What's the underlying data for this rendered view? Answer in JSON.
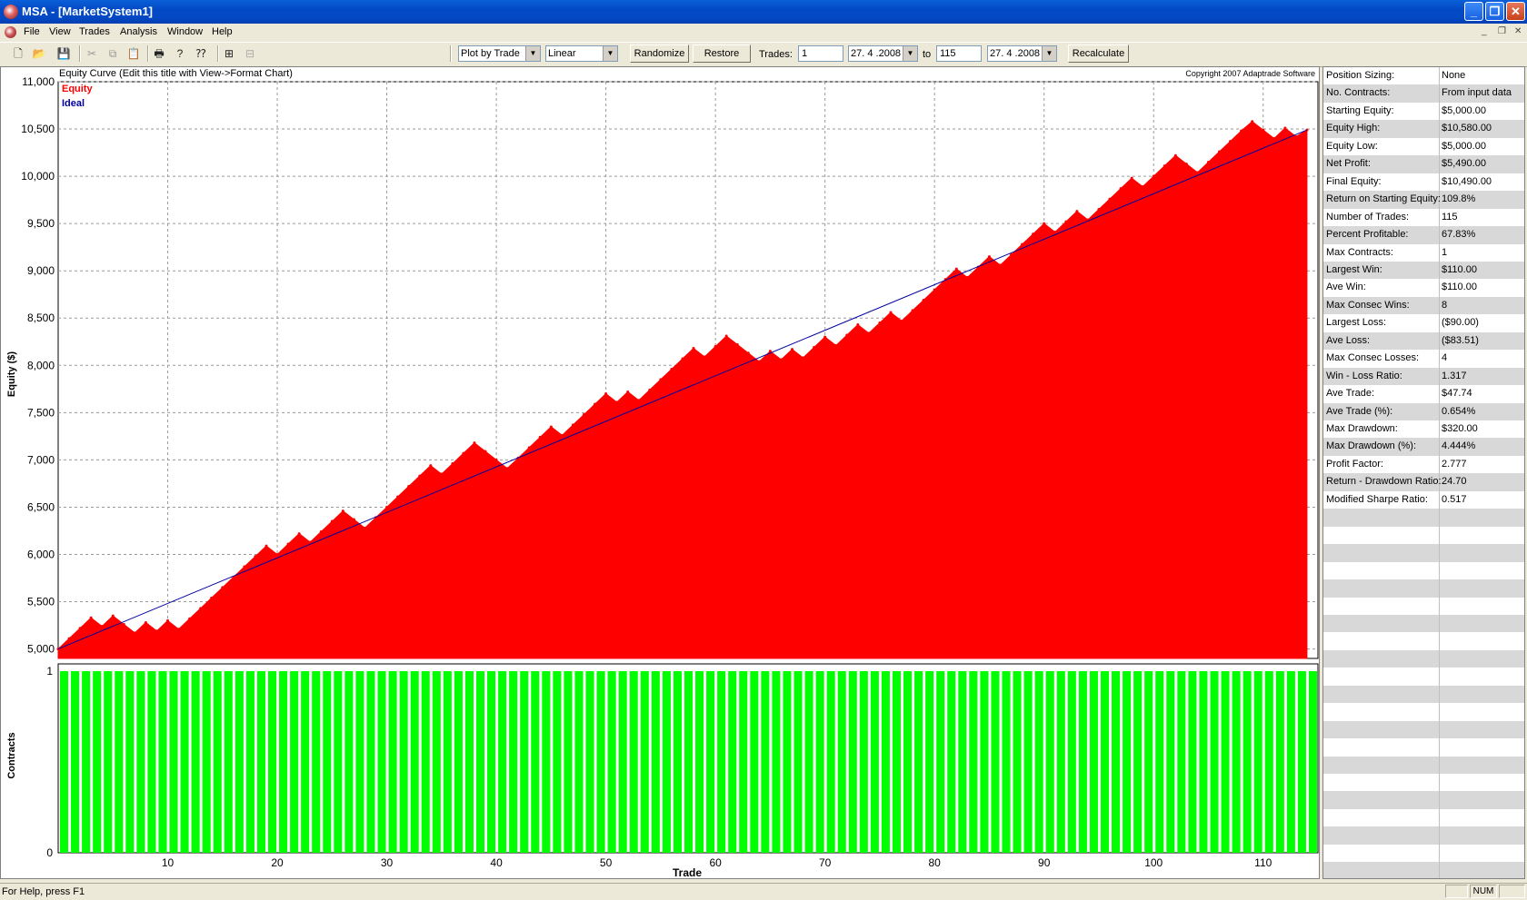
{
  "window": {
    "title": "MSA - [MarketSystem1]"
  },
  "menu": {
    "items": [
      "File",
      "View",
      "Trades",
      "Analysis",
      "Window",
      "Help"
    ]
  },
  "toolbar": {
    "plot_mode": "Plot by Trade",
    "scale": "Linear",
    "randomize_label": "Randomize",
    "restore_label": "Restore",
    "trades_label": "Trades:",
    "trade_from": "1",
    "date_from": "27. 4 .2008",
    "to_label": "to",
    "trade_to": "115",
    "date_to": "27. 4 .2008",
    "recalculate_label": "Recalculate"
  },
  "chart": {
    "title": "Equity Curve (Edit this title with View->Format Chart)",
    "copyright": "Copyright 2007 Adaptrade Software",
    "legend_equity": "Equity",
    "legend_ideal": "Ideal",
    "ylabel": "Equity ($)",
    "ylabel2": "Contracts",
    "xlabel": "Trade",
    "colors": {
      "equity": "#ff0000",
      "ideal": "#0000a0",
      "contracts": "#00ff00"
    }
  },
  "chart_data": [
    {
      "type": "area",
      "title": "Equity Curve (Edit this title with View->Format Chart)",
      "xlabel": "Trade",
      "ylabel": "Equity ($)",
      "xlim": [
        0,
        115
      ],
      "ylim": [
        4900,
        11000
      ],
      "x_ticks": [
        10,
        20,
        30,
        40,
        50,
        60,
        70,
        80,
        90,
        100,
        110
      ],
      "y_ticks": [
        5000,
        5500,
        6000,
        6500,
        7000,
        7500,
        8000,
        8500,
        9000,
        9500,
        10000,
        10500,
        11000
      ],
      "y_tick_labels": [
        "5,000",
        "5,500",
        "6,000",
        "6,500",
        "7,000",
        "7,500",
        "8,000",
        "8,500",
        "9,000",
        "9,500",
        "10,000",
        "10,500",
        "11,000"
      ],
      "grid": true,
      "legend_position": "top-left",
      "series": [
        {
          "name": "Equity",
          "values": [
            5000,
            5110,
            5220,
            5330,
            5240,
            5350,
            5260,
            5170,
            5280,
            5190,
            5300,
            5210,
            5320,
            5430,
            5540,
            5650,
            5760,
            5870,
            5980,
            6090,
            6000,
            6110,
            6220,
            6130,
            6240,
            6350,
            6460,
            6370,
            6280,
            6390,
            6500,
            6610,
            6720,
            6830,
            6940,
            6850,
            6960,
            7070,
            7180,
            7090,
            7000,
            6910,
            7020,
            7130,
            7240,
            7350,
            7260,
            7370,
            7480,
            7590,
            7700,
            7610,
            7720,
            7630,
            7740,
            7850,
            7960,
            8070,
            8180,
            8090,
            8200,
            8310,
            8220,
            8130,
            8040,
            8150,
            8060,
            8170,
            8080,
            8190,
            8300,
            8210,
            8320,
            8430,
            8340,
            8450,
            8560,
            8470,
            8580,
            8690,
            8800,
            8910,
            9020,
            8930,
            9040,
            9150,
            9060,
            9170,
            9280,
            9390,
            9500,
            9410,
            9520,
            9630,
            9540,
            9650,
            9760,
            9870,
            9980,
            9890,
            10000,
            10110,
            10220,
            10130,
            10040,
            10150,
            10260,
            10370,
            10480,
            10580,
            10490,
            10400,
            10510,
            10420,
            10490
          ]
        },
        {
          "name": "Ideal",
          "values_start": 5000,
          "values_end": 10490
        }
      ]
    },
    {
      "type": "bar",
      "xlabel": "Trade",
      "ylabel": "Contracts",
      "xlim": [
        0,
        115
      ],
      "ylim": [
        0,
        1
      ],
      "y_ticks": [
        0,
        1
      ],
      "series": [
        {
          "name": "Contracts",
          "value_each_trade": 1,
          "count": 115
        }
      ]
    }
  ],
  "stats": [
    {
      "k": "Position Sizing:",
      "v": "None"
    },
    {
      "k": "No. Contracts:",
      "v": "From input data"
    },
    {
      "k": "Starting Equity:",
      "v": "$5,000.00"
    },
    {
      "k": "Equity High:",
      "v": "$10,580.00"
    },
    {
      "k": "Equity Low:",
      "v": "$5,000.00"
    },
    {
      "k": "Net Profit:",
      "v": "$5,490.00"
    },
    {
      "k": "Final Equity:",
      "v": "$10,490.00"
    },
    {
      "k": "Return on Starting Equity:",
      "v": "109.8%"
    },
    {
      "k": "Number of Trades:",
      "v": "115"
    },
    {
      "k": "Percent Profitable:",
      "v": "67.83%"
    },
    {
      "k": "Max Contracts:",
      "v": "1"
    },
    {
      "k": "Largest Win:",
      "v": "$110.00"
    },
    {
      "k": "Ave Win:",
      "v": "$110.00"
    },
    {
      "k": "Max Consec Wins:",
      "v": "8"
    },
    {
      "k": "Largest Loss:",
      "v": "($90.00)"
    },
    {
      "k": "Ave Loss:",
      "v": "($83.51)"
    },
    {
      "k": "Max Consec Losses:",
      "v": "4"
    },
    {
      "k": "Win - Loss Ratio:",
      "v": "1.317"
    },
    {
      "k": "Ave Trade:",
      "v": "$47.74"
    },
    {
      "k": "Ave Trade (%):",
      "v": "0.654%"
    },
    {
      "k": "Max Drawdown:",
      "v": "$320.00"
    },
    {
      "k": "Max Drawdown (%):",
      "v": "4.444%"
    },
    {
      "k": "Profit Factor:",
      "v": "2.777"
    },
    {
      "k": "Return - Drawdown Ratio:",
      "v": "24.70"
    },
    {
      "k": "Modified Sharpe Ratio:",
      "v": "0.517"
    }
  ],
  "status": {
    "message": "For Help, press F1",
    "num": "NUM"
  }
}
